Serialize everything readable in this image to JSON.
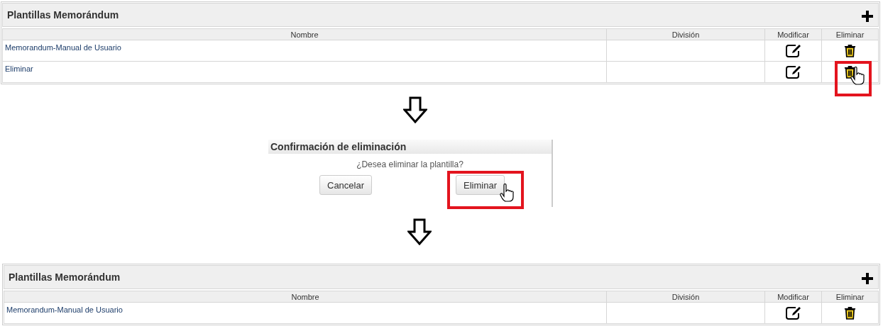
{
  "steps": [
    {
      "kind": "table_panel",
      "title": "Plantillas Memorándum",
      "columns": [
        "Nombre",
        "División",
        "Modificar",
        "Eliminar"
      ],
      "rows": [
        {
          "nombre": "Memorandum-Manual de Usuario",
          "highlighted": false
        },
        {
          "nombre": "Eliminar",
          "highlighted": true
        }
      ]
    },
    {
      "kind": "arrow"
    },
    {
      "kind": "dialog",
      "title": "Confirmación de eliminación",
      "message": "¿Desea eliminar la plantilla?",
      "buttons": [
        {
          "label": "Cancelar",
          "highlighted": false
        },
        {
          "label": "Eliminar",
          "highlighted": true
        }
      ]
    },
    {
      "kind": "arrow"
    },
    {
      "kind": "table_panel",
      "title": "Plantillas Memorándum",
      "columns": [
        "Nombre",
        "División",
        "Modificar",
        "Eliminar"
      ],
      "rows": [
        {
          "nombre": "Memorandum-Manual de Usuario",
          "highlighted": false
        }
      ]
    }
  ]
}
